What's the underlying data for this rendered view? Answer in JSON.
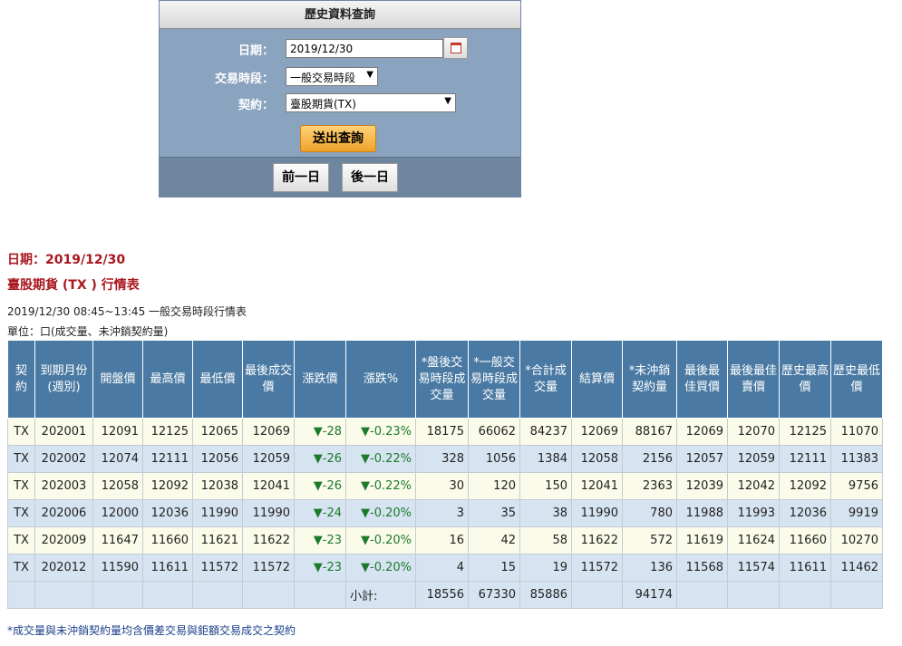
{
  "query_panel": {
    "title": "歷史資料查詢",
    "date_label": "日期：",
    "date_value": "2019/12/30",
    "session_label": "交易時段：",
    "session_value": "一般交易時段",
    "contract_label": "契約：",
    "contract_value": "臺股期貨(TX)",
    "submit_label": "送出查詢",
    "prev_label": "前一日",
    "next_label": "後一日"
  },
  "report": {
    "date_heading": "日期：2019/12/30",
    "contract_heading": "臺股期貨 (TX ) 行情表",
    "session_line": "2019/12/30  08:45~13:45 一般交易時段行情表",
    "unit_line": "單位：口(成交量、未沖銷契約量)"
  },
  "table": {
    "headers": [
      "契約",
      "到期月份(週別)",
      "開盤價",
      "最高價",
      "最低價",
      "最後成交價",
      "漲跌價",
      "漲跌%",
      "*盤後交易時段成交量",
      "*一般交易時段成交量",
      "*合計成交量",
      "結算價",
      "*未沖銷契約量",
      "最後最佳買價",
      "最後最佳賣價",
      "歷史最高價",
      "歷史最低價"
    ],
    "rows": [
      [
        "TX",
        "202001",
        "12091",
        "12125",
        "12065",
        "12069",
        "▼-28",
        "▼-0.23%",
        "18175",
        "66062",
        "84237",
        "12069",
        "88167",
        "12069",
        "12070",
        "12125",
        "11070"
      ],
      [
        "TX",
        "202002",
        "12074",
        "12111",
        "12056",
        "12059",
        "▼-26",
        "▼-0.22%",
        "328",
        "1056",
        "1384",
        "12058",
        "2156",
        "12057",
        "12059",
        "12111",
        "11383"
      ],
      [
        "TX",
        "202003",
        "12058",
        "12092",
        "12038",
        "12041",
        "▼-26",
        "▼-0.22%",
        "30",
        "120",
        "150",
        "12041",
        "2363",
        "12039",
        "12042",
        "12092",
        "9756"
      ],
      [
        "TX",
        "202006",
        "12000",
        "12036",
        "11990",
        "11990",
        "▼-24",
        "▼-0.20%",
        "3",
        "35",
        "38",
        "11990",
        "780",
        "11988",
        "11993",
        "12036",
        "9919"
      ],
      [
        "TX",
        "202009",
        "11647",
        "11660",
        "11621",
        "11622",
        "▼-23",
        "▼-0.20%",
        "16",
        "42",
        "58",
        "11622",
        "572",
        "11619",
        "11624",
        "11660",
        "10270"
      ],
      [
        "TX",
        "202012",
        "11590",
        "11611",
        "11572",
        "11572",
        "▼-23",
        "▼-0.20%",
        "4",
        "15",
        "19",
        "11572",
        "136",
        "11568",
        "11574",
        "11611",
        "11462"
      ]
    ],
    "subtotal_label": "小計:",
    "subtotal_after_hours": "18556",
    "subtotal_regular": "67330",
    "subtotal_total": "85886",
    "subtotal_open_interest": "94174"
  },
  "footnote": "*成交量與未沖銷契約量均含價差交易與鉅額交易成交之契約",
  "colors": {
    "header_bg": "#4a7aa3",
    "down_green": "#1d7a2c",
    "heading_red": "#a8171e"
  }
}
